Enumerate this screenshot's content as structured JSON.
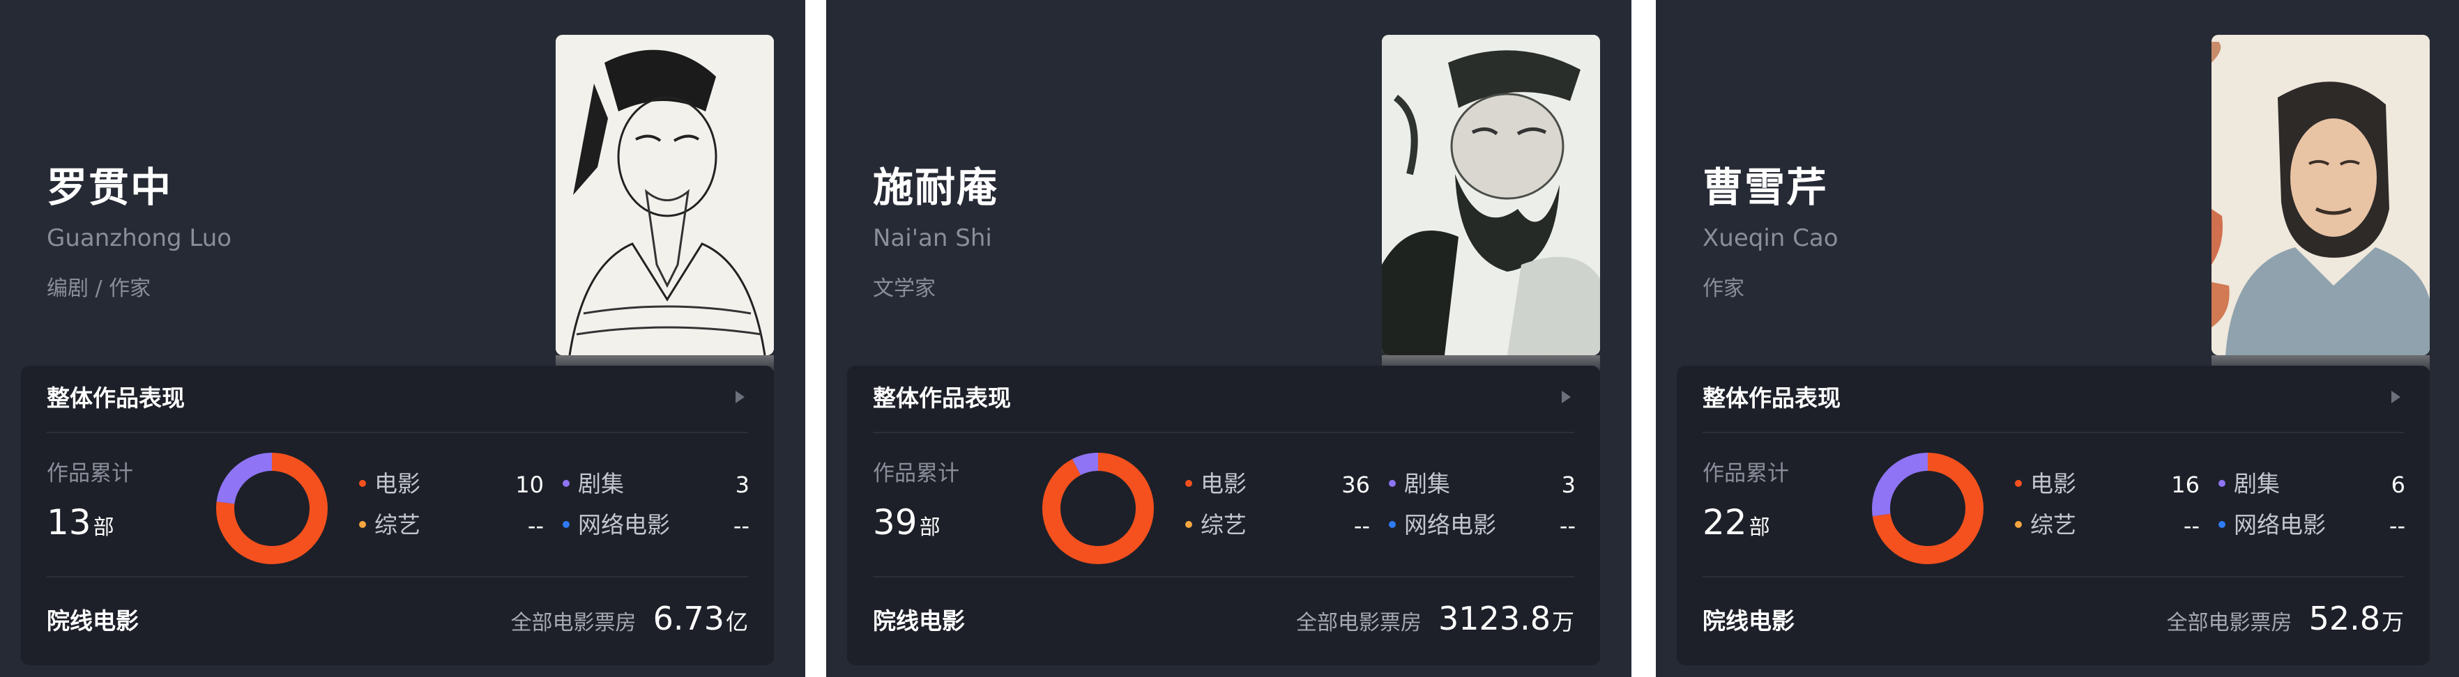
{
  "colors": {
    "movie": "#f4511e",
    "series": "#8f74f5",
    "variety": "#f5a641",
    "web_movie": "#2f7bf5",
    "card_bg": "#262a35",
    "panel_bg": "#1d2029"
  },
  "cards": [
    {
      "name": "罗贯中",
      "english_name": "Guanzhong Luo",
      "role": "编剧 / 作家",
      "portrait_icon": "portrait-ink-sketch",
      "panel_title": "整体作品表现",
      "works_label": "作品累计",
      "works_count": "13",
      "works_unit": "部",
      "donut": {
        "movie": 10,
        "series": 3
      },
      "legend": {
        "movie_label": "电影",
        "movie_value": "10",
        "series_label": "剧集",
        "series_value": "3",
        "variety_label": "综艺",
        "variety_value": "--",
        "web_label": "网络电影",
        "web_value": "--"
      },
      "cinema_label": "院线电影",
      "box_office_label": "全部电影票房",
      "box_office_value": "6.73",
      "box_office_unit": "亿"
    },
    {
      "name": "施耐庵",
      "english_name": "Nai'an Shi",
      "role": "文学家",
      "portrait_icon": "portrait-ink-wash",
      "panel_title": "整体作品表现",
      "works_label": "作品累计",
      "works_count": "39",
      "works_unit": "部",
      "donut": {
        "movie": 36,
        "series": 3
      },
      "legend": {
        "movie_label": "电影",
        "movie_value": "36",
        "series_label": "剧集",
        "series_value": "3",
        "variety_label": "综艺",
        "variety_value": "--",
        "web_label": "网络电影",
        "web_value": "--"
      },
      "cinema_label": "院线电影",
      "box_office_label": "全部电影票房",
      "box_office_value": "3123.8",
      "box_office_unit": "万"
    },
    {
      "name": "曹雪芹",
      "english_name": "Xueqin Cao",
      "role": "作家",
      "portrait_icon": "portrait-color-painting",
      "panel_title": "整体作品表现",
      "works_label": "作品累计",
      "works_count": "22",
      "works_unit": "部",
      "donut": {
        "movie": 16,
        "series": 6
      },
      "legend": {
        "movie_label": "电影",
        "movie_value": "16",
        "series_label": "剧集",
        "series_value": "6",
        "variety_label": "综艺",
        "variety_value": "--",
        "web_label": "网络电影",
        "web_value": "--"
      },
      "cinema_label": "院线电影",
      "box_office_label": "全部电影票房",
      "box_office_value": "52.8",
      "box_office_unit": "万"
    }
  ]
}
